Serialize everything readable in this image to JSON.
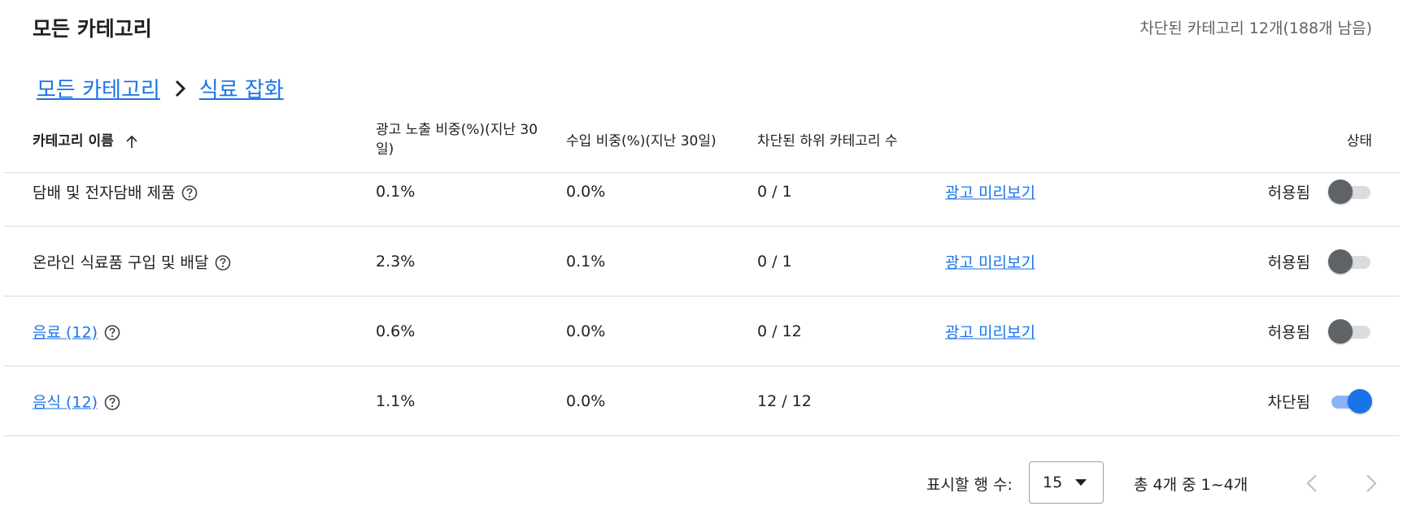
{
  "header": {
    "title": "모든 카테고리",
    "summary": "차단된 카테고리 12개(188개 남음)"
  },
  "breadcrumb": {
    "root": "모든 카테고리",
    "current": "식료 잡화"
  },
  "table": {
    "columns": {
      "name": "카테고리 이름",
      "reach": "광고 노출 비중(%)(지난 30일)",
      "revenue": "수입 비중(%)(지난 30일)",
      "blocked_sub": "차단된 하위 카테고리 수",
      "status": "상태"
    },
    "rows": [
      {
        "name": "담배 및 전자담배 제품",
        "reach": "0.1%",
        "revenue": "0.0%",
        "blocked": "0 / 1",
        "preview": "광고 미리보기",
        "state": "허용됨"
      },
      {
        "name": "온라인 식료품 구입 및 배달",
        "reach": "2.3%",
        "revenue": "0.1%",
        "blocked": "0 / 1",
        "preview": "광고 미리보기",
        "state": "허용됨"
      },
      {
        "name": "음료 (12)",
        "reach": "0.6%",
        "revenue": "0.0%",
        "blocked": "0 / 12",
        "preview": "광고 미리보기",
        "state": "허용됨"
      },
      {
        "name": "음식 (12)",
        "reach": "1.1%",
        "revenue": "0.0%",
        "blocked": "12 / 12",
        "state": "차단됨"
      }
    ]
  },
  "footer": {
    "rows_label": "표시할 행 수:",
    "rows_value": "15",
    "range": "총 4개 중 1~4개"
  },
  "colors": {
    "accent": "#1a73e8",
    "toggle_on_track": "#8ab4f8",
    "toggle_off_thumb": "#5f6368"
  }
}
